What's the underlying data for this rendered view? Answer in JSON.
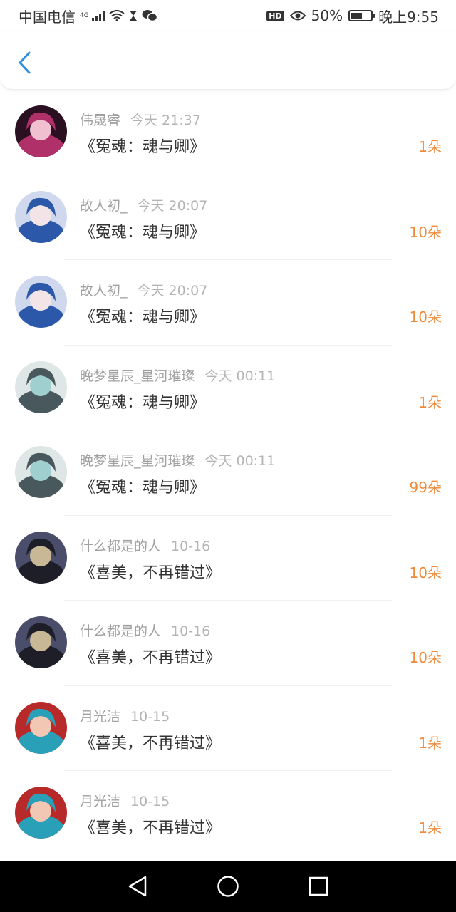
{
  "status_bar": {
    "carrier": "中国电信",
    "network": "4G",
    "battery_text": "50%",
    "battery_level": 0.5,
    "time": "晚上9:55",
    "hd": "HD"
  },
  "items": [
    {
      "name": "伟晟睿",
      "time": "今天 21:37",
      "title": "《冤魂：魂与卿》",
      "count": "1朵",
      "avatar_colors": [
        "#2a1020",
        "#b0306a",
        "#f0c0d0"
      ]
    },
    {
      "name": "故人初_",
      "time": "今天 20:07",
      "title": "《冤魂：魂与卿》",
      "count": "10朵",
      "avatar_colors": [
        "#cfd8ec",
        "#2b58a8",
        "#f3e4e8"
      ]
    },
    {
      "name": "故人初_",
      "time": "今天 20:07",
      "title": "《冤魂：魂与卿》",
      "count": "10朵",
      "avatar_colors": [
        "#cfd8ec",
        "#2b58a8",
        "#f3e4e8"
      ]
    },
    {
      "name": "晚梦星辰_星河璀璨",
      "time": "今天 00:11",
      "title": "《冤魂：魂与卿》",
      "count": "1朵",
      "avatar_colors": [
        "#dfe6e6",
        "#49585c",
        "#9fd0cf"
      ]
    },
    {
      "name": "晚梦星辰_星河璀璨",
      "time": "今天 00:11",
      "title": "《冤魂：魂与卿》",
      "count": "99朵",
      "avatar_colors": [
        "#dfe6e6",
        "#49585c",
        "#9fd0cf"
      ]
    },
    {
      "name": "什么都是的人",
      "time": "10-16",
      "title": "《喜美，不再错过》",
      "count": "10朵",
      "avatar_colors": [
        "#4a4e6a",
        "#1e1e28",
        "#c9b896"
      ]
    },
    {
      "name": "什么都是的人",
      "time": "10-16",
      "title": "《喜美，不再错过》",
      "count": "10朵",
      "avatar_colors": [
        "#4a4e6a",
        "#1e1e28",
        "#c9b896"
      ]
    },
    {
      "name": "月光洁",
      "time": "10-15",
      "title": "《喜美，不再错过》",
      "count": "1朵",
      "avatar_colors": [
        "#b82a2a",
        "#2aa0b8",
        "#f2c8b4"
      ]
    },
    {
      "name": "月光洁",
      "time": "10-15",
      "title": "《喜美，不再错过》",
      "count": "1朵",
      "avatar_colors": [
        "#b82a2a",
        "#2aa0b8",
        "#f2c8b4"
      ]
    }
  ],
  "colors": {
    "accent_blue": "#2f8fe0",
    "count_orange": "#f08a3a",
    "meta_gray": "#a0a0a0"
  },
  "icons": {
    "back": "chevron-left-icon",
    "nav_back": "triangle-back-icon",
    "nav_home": "circle-home-icon",
    "nav_recent": "square-recent-icon"
  }
}
